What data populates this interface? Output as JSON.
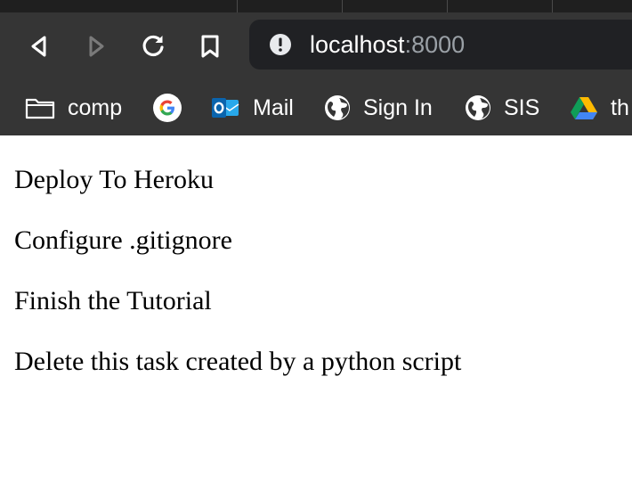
{
  "browser": {
    "address_bar": {
      "host": "localhost",
      "port": ":8000"
    },
    "nav": {
      "back_icon": "back-arrow-icon",
      "forward_icon": "forward-arrow-icon",
      "reload_icon": "reload-icon",
      "bookmark_icon": "bookmark-icon",
      "site_info_icon": "info-icon"
    },
    "bookmarks": [
      {
        "label": "comp",
        "icon": "folder-icon"
      },
      {
        "label": "",
        "icon": "google-icon"
      },
      {
        "label": "Mail",
        "icon": "outlook-icon"
      },
      {
        "label": "Sign In",
        "icon": "globe-icon"
      },
      {
        "label": "SIS",
        "icon": "globe-icon"
      },
      {
        "label": "th",
        "icon": "google-drive-icon"
      }
    ]
  },
  "page": {
    "tasks": [
      "Deploy To Heroku",
      "Configure .gitignore",
      "Finish the Tutorial",
      "Delete this task created by a python script"
    ]
  }
}
